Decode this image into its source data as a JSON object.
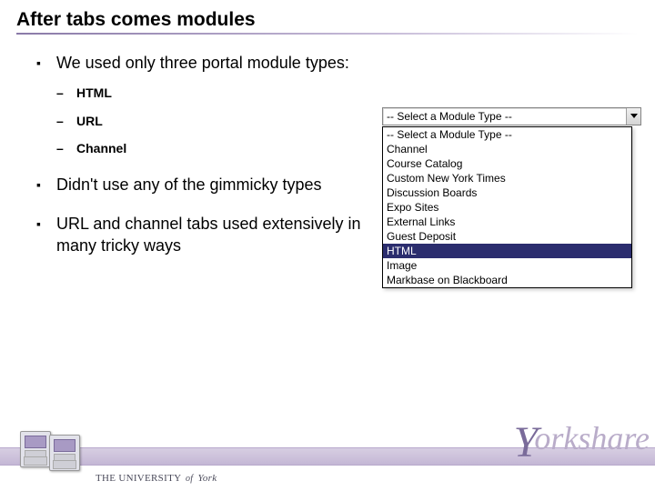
{
  "title": "After tabs comes modules",
  "bullets": {
    "item1": "We used only three portal module types:",
    "sub1": "HTML",
    "sub2": "URL",
    "sub3": "Channel",
    "item2": "Didn't use any of the gimmicky types",
    "item3": "URL and channel tabs used extensively in many tricky ways"
  },
  "dropdown": {
    "closed_value": "-- Select a Module Type --",
    "options": {
      "o0": "-- Select a Module Type --",
      "o1": "Channel",
      "o2": "Course Catalog",
      "o3": "Custom New York Times",
      "o4": "Discussion Boards",
      "o5": "Expo Sites",
      "o6": "External Links",
      "o7": "Guest Deposit",
      "o8": "HTML",
      "o9": "Image",
      "o10": "Markbase on Blackboard"
    }
  },
  "footer": {
    "university_pre": "THE UNIVERSITY",
    "university_of": "of",
    "university_name": "York",
    "brand": "orkshare",
    "brand_y": "Y"
  }
}
